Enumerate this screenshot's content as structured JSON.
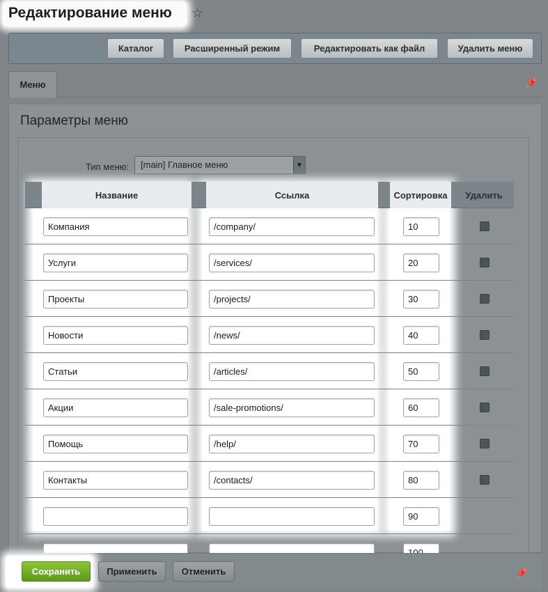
{
  "header": {
    "title": "Редактирование меню"
  },
  "toolbar": {
    "buttons": [
      "Каталог",
      "Расширенный режим",
      "Редактировать как файл",
      "Удалить меню"
    ]
  },
  "tabs": [
    {
      "label": "Меню",
      "active": true
    }
  ],
  "section": {
    "title": "Параметры меню"
  },
  "menu_type": {
    "label": "Тип меню:",
    "value": "[main] Главное меню"
  },
  "table": {
    "headers": {
      "name": "Название",
      "link": "Ссылка",
      "sort": "Сортировка",
      "delete": "Удалить"
    },
    "rows": [
      {
        "name": "Компания",
        "link": "/company/",
        "sort": "10",
        "deletable": true
      },
      {
        "name": "Услуги",
        "link": "/services/",
        "sort": "20",
        "deletable": true
      },
      {
        "name": "Проекты",
        "link": "/projects/",
        "sort": "30",
        "deletable": true
      },
      {
        "name": "Новости",
        "link": "/news/",
        "sort": "40",
        "deletable": true
      },
      {
        "name": "Статьи",
        "link": "/articles/",
        "sort": "50",
        "deletable": true
      },
      {
        "name": "Акции",
        "link": "/sale-promotions/",
        "sort": "60",
        "deletable": true
      },
      {
        "name": "Помощь",
        "link": "/help/",
        "sort": "70",
        "deletable": true
      },
      {
        "name": "Контакты",
        "link": "/contacts/",
        "sort": "80",
        "deletable": true
      },
      {
        "name": "",
        "link": "",
        "sort": "90",
        "deletable": false
      },
      {
        "name": "",
        "link": "",
        "sort": "100",
        "deletable": false
      }
    ]
  },
  "footer": {
    "save": "Сохранить",
    "apply": "Применить",
    "cancel": "Отменить"
  },
  "icons": {
    "favorite": "star-icon",
    "pin": "pin-icon",
    "dropdown": "chevron-down-icon"
  },
  "colors": {
    "save_button": "#6fae24",
    "highlight": "#ffffff",
    "overlay_bg": "#7f8588"
  }
}
